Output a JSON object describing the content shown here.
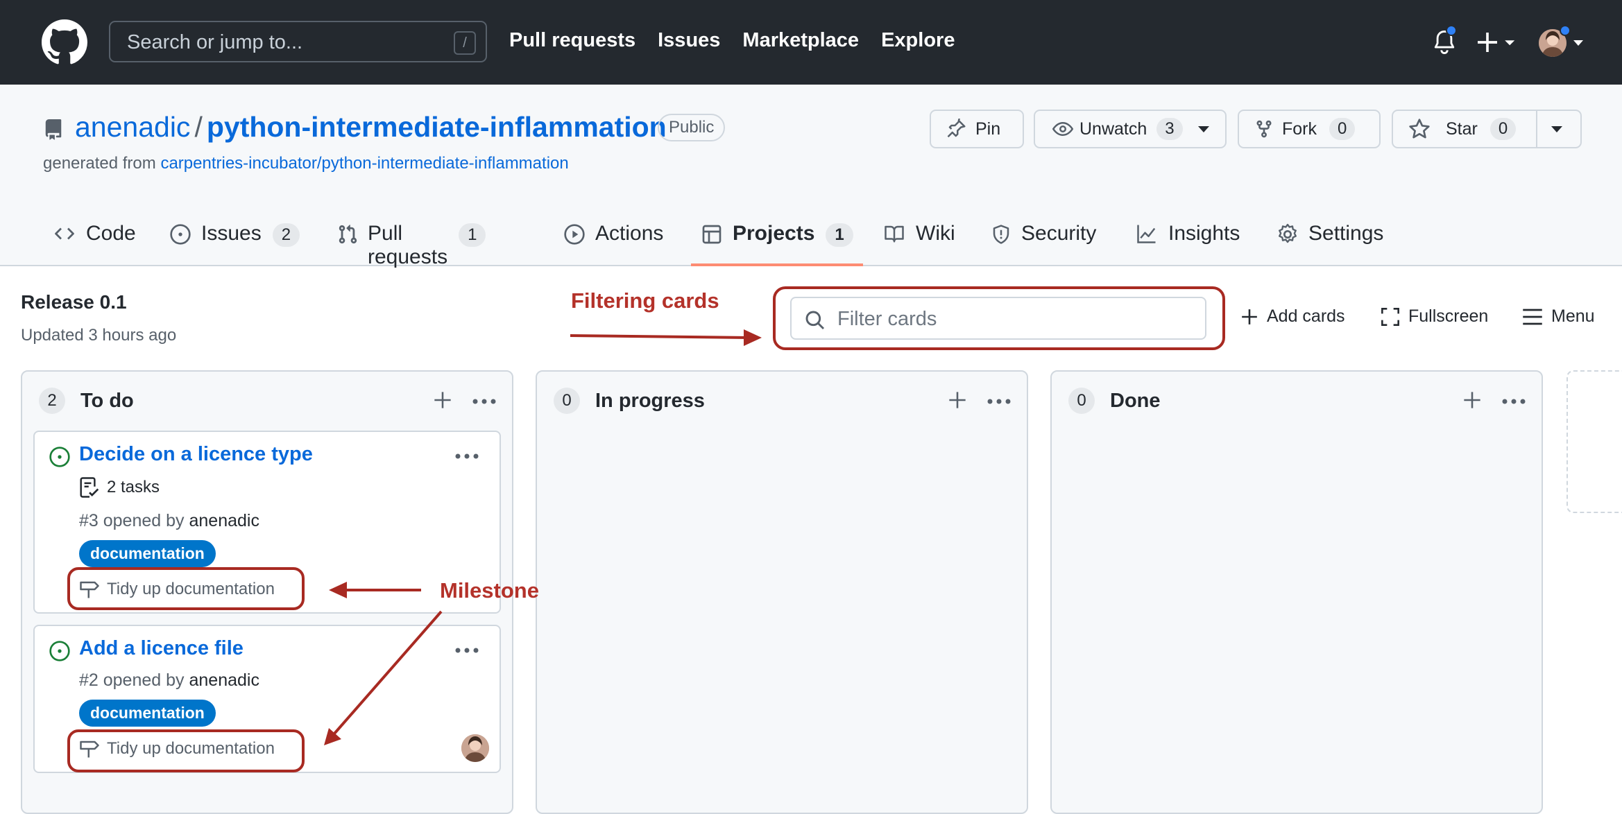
{
  "topnav": {
    "search_placeholder": "Search or jump to...",
    "search_shortcut": "/",
    "links": [
      "Pull requests",
      "Issues",
      "Marketplace",
      "Explore"
    ]
  },
  "repo": {
    "owner": "anenadic",
    "separator": "/",
    "name": "python-intermediate-inflammation",
    "visibility": "Public",
    "generated_prefix": "generated from ",
    "generated_source": "carpentries-incubator/python-intermediate-inflammation",
    "buttons": {
      "pin": "Pin",
      "unwatch": "Unwatch",
      "unwatch_count": "3",
      "fork": "Fork",
      "fork_count": "0",
      "star": "Star",
      "star_count": "0"
    }
  },
  "tabs": [
    {
      "label": "Code",
      "count": null
    },
    {
      "label": "Issues",
      "count": "2"
    },
    {
      "label": "Pull requests",
      "count": "1"
    },
    {
      "label": "Actions",
      "count": null
    },
    {
      "label": "Projects",
      "count": "1"
    },
    {
      "label": "Wiki",
      "count": null
    },
    {
      "label": "Security",
      "count": null
    },
    {
      "label": "Insights",
      "count": null
    },
    {
      "label": "Settings",
      "count": null
    }
  ],
  "project": {
    "name": "Release 0.1",
    "updated": "Updated 3 hours ago",
    "filter_placeholder": "Filter cards",
    "add_cards": "Add cards",
    "fullscreen": "Fullscreen",
    "menu": "Menu"
  },
  "columns": [
    {
      "count": "2",
      "title": "To do",
      "cards": [
        {
          "title": "Decide on a licence type",
          "tasks": "2 tasks",
          "issue_ref": "#3 opened by ",
          "author": "anenadic",
          "label": "documentation",
          "milestone": "Tidy up documentation"
        },
        {
          "title": "Add a licence file",
          "issue_ref": "#2 opened by ",
          "author": "anenadic",
          "label": "documentation",
          "milestone": "Tidy up documentation"
        }
      ]
    },
    {
      "count": "0",
      "title": "In progress"
    },
    {
      "count": "0",
      "title": "Done"
    }
  ],
  "annotations": {
    "filter_label": "Filtering cards",
    "milestone_label": "Milestone",
    "color": "#b4322a"
  },
  "colors": {
    "topbar": "#24292f",
    "link": "#0969da",
    "label_bg": "#0075ca",
    "open_issue": "#1a7f37",
    "active_tab_underline": "#fd8c73"
  }
}
